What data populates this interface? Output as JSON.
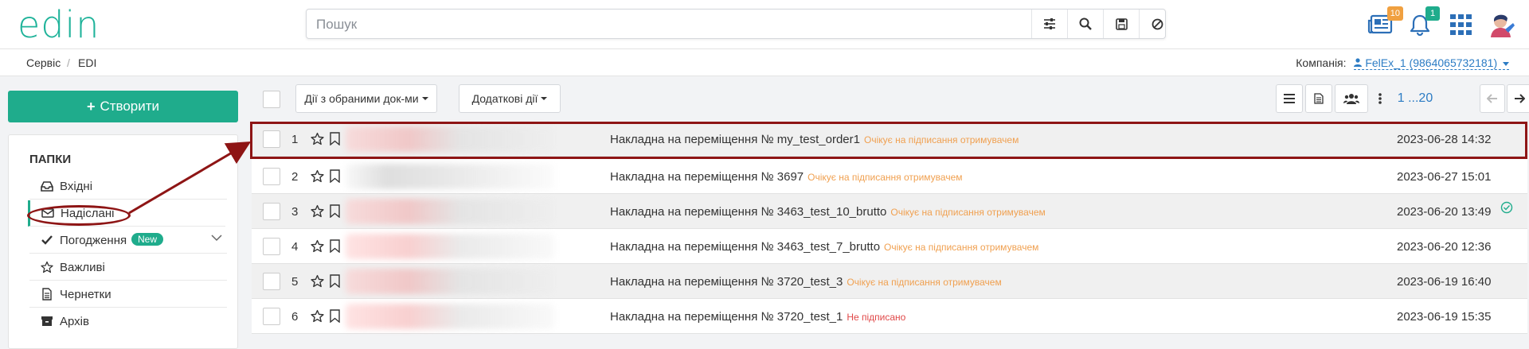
{
  "header": {
    "logo_text": "edin",
    "search_placeholder": "Пошук",
    "search_buttons": [
      "sliders-icon",
      "search-icon",
      "save-icon",
      "ban-icon"
    ],
    "newspaper_badge": "10",
    "bell_badge": "1"
  },
  "breadcrumbs": {
    "items": [
      "Сервіс",
      "EDI"
    ],
    "separator": "/",
    "company_label": "Компанія:",
    "company_value": "FelEx_1 (9864065732181)"
  },
  "sidebar": {
    "create_label": "Створити",
    "folders_title": "ПАПКИ",
    "items": [
      {
        "label": "Вхідні",
        "icon": "inbox-icon"
      },
      {
        "label": "Надіслані",
        "icon": "envelope-icon",
        "active": true
      },
      {
        "label": "Погодження",
        "icon": "check-icon",
        "badge": "New"
      },
      {
        "label": "Важливі",
        "icon": "star-icon"
      },
      {
        "label": "Чернетки",
        "icon": "file-icon"
      },
      {
        "label": "Архів",
        "icon": "archive-icon"
      }
    ]
  },
  "toolbar": {
    "bulk_actions_label": "Дії з обраними док-ми",
    "extra_actions_label": "Додаткові дії",
    "pager_text": "1 ...20"
  },
  "documents": [
    {
      "num": "1",
      "title": "Накладна на переміщення № my_test_order1",
      "status": "Очікує на підписання отримувачем",
      "date": "2023-06-28 14:32"
    },
    {
      "num": "2",
      "title": "Накладна на переміщення № 3697",
      "status": "Очікує на підписання отримувачем",
      "date": "2023-06-27 15:01"
    },
    {
      "num": "3",
      "title": "Накладна на переміщення № 3463_test_10_brutto",
      "status": "Очікує на підписання отримувачем",
      "date": "2023-06-20 13:49"
    },
    {
      "num": "4",
      "title": "Накладна на переміщення № 3463_test_7_brutto",
      "status": "Очікує на підписання отримувачем",
      "date": "2023-06-20 12:36"
    },
    {
      "num": "5",
      "title": "Накладна на переміщення № 3720_test_3",
      "status": "Очікує на підписання отримувачем",
      "date": "2023-06-19 16:40"
    },
    {
      "num": "6",
      "title": "Накладна на переміщення № 3720_test_1",
      "status": "Не підписано",
      "date": "2023-06-19 15:35"
    }
  ],
  "colors": {
    "brand": "#1fac8c",
    "status_pending": "#f0a050",
    "status_unsigned": "#e04848",
    "annotation": "#8e1515",
    "link": "#2c7cc4"
  }
}
